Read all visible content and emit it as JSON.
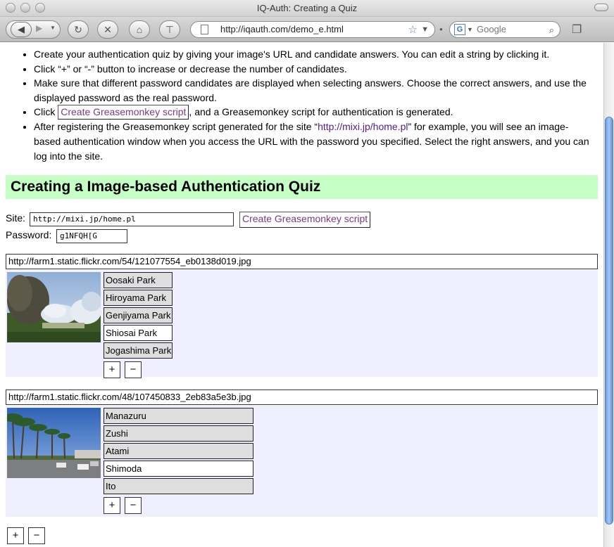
{
  "window": {
    "title": "IQ-Auth: Creating a Quiz"
  },
  "toolbar": {
    "back_icon": "back-arrow-icon",
    "forward_icon": "forward-arrow-icon",
    "url": "http://iqauth.com/demo_e.html",
    "search_placeholder": "Google"
  },
  "instructions": {
    "item1": "Create your authentication quiz by giving your image's URL and candidate answers. You can edit a string by clicking it.",
    "item2": "Click “+” or “-” button to increase or decrease the number of candidates.",
    "item3": "Make sure that different password candidates are displayed when selecting answers. Choose the correct answers, and use the displayed password as the real password.",
    "item4_pre": "Click",
    "item4_button": "Create Greasemonkey script",
    "item4_post": ", and a Greasemonkey script for authentication is generated.",
    "item5_pre": "After registering the Greasemonkey script generated for the site “",
    "item5_link": "http://mixi.jp/home.pl",
    "item5_post": "” for example, you will see an image-based authentication window when you access the URL with the password you specified. Select the right answers, and you can log into the site."
  },
  "section": {
    "title": "Creating a Image-based Authentication Quiz"
  },
  "form": {
    "site_label": "Site:",
    "site_value": "http://mixi.jp/home.pl",
    "create_button": "Create Greasemonkey script",
    "password_label": "Password:",
    "password_value": "g1NFQH[G"
  },
  "quizzes": [
    {
      "image_url": "http://farm1.static.flickr.com/54/121077554_eb0138d019.jpg",
      "answers": [
        "Oosaki Park",
        "Hiroyama Park",
        "Genjiyama Park",
        "Shiosai Park",
        "Jogashima Park"
      ],
      "selected_index": 3
    },
    {
      "image_url": "http://farm1.static.flickr.com/48/107450833_2eb83a5e3b.jpg",
      "answers": [
        "Manazuru",
        "Zushi",
        "Atami",
        "Shimoda",
        "Ito"
      ],
      "selected_index": 3
    }
  ],
  "buttons": {
    "plus": "+",
    "minus": "−"
  },
  "colors": {
    "section_bg": "#c6ffc6",
    "quiz_bg": "#efefff",
    "link": "#551a8b",
    "button_text": "#7b3b7e"
  }
}
